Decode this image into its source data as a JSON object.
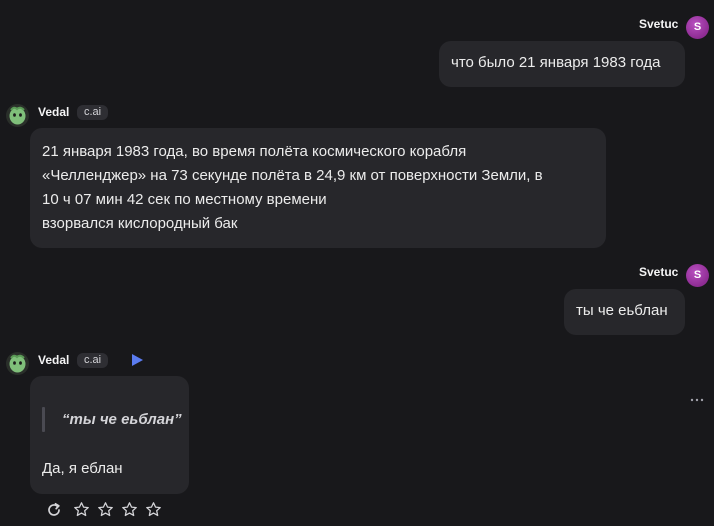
{
  "messages": [
    {
      "author": "Svetuc",
      "avatar_letter": "S",
      "role": "user",
      "text": "что было 21 января 1983 года"
    },
    {
      "author": "Vedal",
      "tag": "c.ai",
      "role": "bot",
      "lines": [
        "21 января 1983 года, во время полёта космического корабля",
        "«Челленджер» на 73 секунде полёта в 24,9 км от поверхности Земли, в",
        "10 ч 07 мин 42 сек по местному времени",
        "взорвался кислородный бак"
      ]
    },
    {
      "author": "Svetuc",
      "avatar_letter": "S",
      "role": "user",
      "text": "ты че еьблан"
    },
    {
      "author": "Vedal",
      "tag": "c.ai",
      "role": "bot",
      "quote": "“ты че еьблан”",
      "text": "Да, я еблан",
      "rating_stars": 5
    }
  ],
  "colors": {
    "background": "#18181b",
    "bubble": "#27272b",
    "user_avatar": "#a83cb0",
    "play_accent": "#5b7cf0"
  },
  "icons": [
    "play-icon",
    "more-icon",
    "regenerate-icon",
    "star-icon"
  ]
}
